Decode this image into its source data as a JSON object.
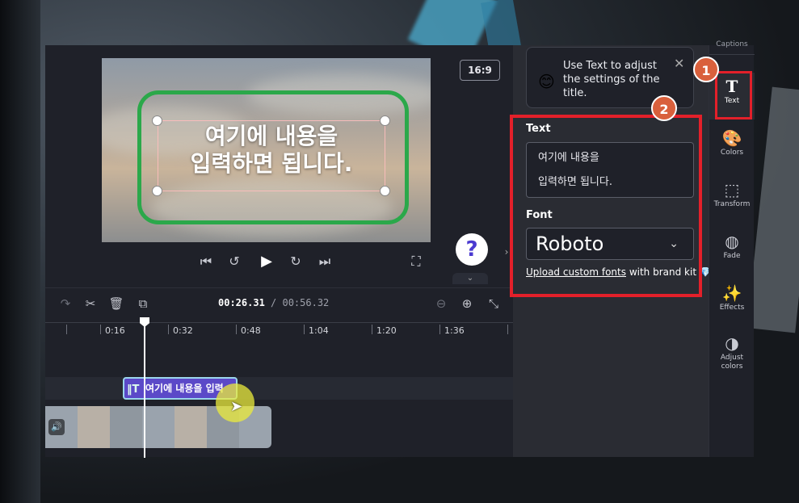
{
  "preview": {
    "aspect_ratio": "16:9",
    "overlay_text": "여기에 내용을\n입력하면 됩니다.",
    "help_label": "?"
  },
  "timeline": {
    "current_time": "00:26.31",
    "separator": " / ",
    "total_time": "00:56.32",
    "ticks": [
      "0:16",
      "0:32",
      "0:48",
      "1:04",
      "1:20",
      "1:36"
    ],
    "text_clip_label": "여기에 내용을 입력"
  },
  "panel": {
    "tip_text": "Use Text to adjust the settings of the title.",
    "text_label": "Text",
    "text_value": "여기에 내용을\n입력하면 됩니다.",
    "font_label": "Font",
    "font_value": "Roboto",
    "upload_link": "Upload custom fonts",
    "upload_suffix": " with brand kit"
  },
  "rail": {
    "top_label": "Captions",
    "items": [
      {
        "label": "Text",
        "icon": "text-icon"
      },
      {
        "label": "Colors",
        "icon": "palette-icon"
      },
      {
        "label": "Transform",
        "icon": "transform-icon"
      },
      {
        "label": "Fade",
        "icon": "fade-icon"
      },
      {
        "label": "Effects",
        "icon": "effects-icon"
      },
      {
        "label": "Adjust colors",
        "icon": "adjust-colors-icon"
      }
    ]
  },
  "annotations": {
    "badge1": "1",
    "badge2": "2"
  }
}
